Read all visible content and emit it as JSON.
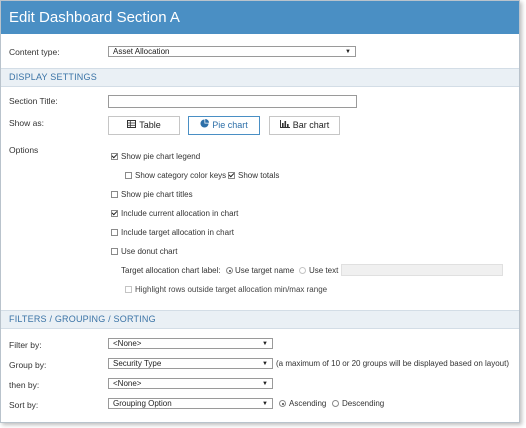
{
  "title": "Edit Dashboard Section A",
  "content_type": {
    "label": "Content type:",
    "value": "Asset Allocation"
  },
  "display_settings": {
    "heading": "DISPLAY SETTINGS",
    "section_title_label": "Section Title:",
    "section_title_value": "",
    "show_as_label": "Show as:",
    "buttons": {
      "table": "Table",
      "pie": "Pie chart",
      "bar": "Bar chart"
    },
    "selected": "Pie chart",
    "options_label": "Options",
    "options": {
      "show_legend": {
        "label": "Show pie chart legend",
        "checked": true
      },
      "show_color_keys": {
        "label": "Show category color keys",
        "checked": false
      },
      "show_totals": {
        "label": "Show totals",
        "checked": true
      },
      "show_titles": {
        "label": "Show pie chart titles",
        "checked": false
      },
      "include_current": {
        "label": "Include current allocation in chart",
        "checked": true
      },
      "include_target": {
        "label": "Include target allocation in chart",
        "checked": false
      },
      "use_donut": {
        "label": "Use donut chart",
        "checked": false
      }
    },
    "target_label": {
      "label": "Target allocation chart label:",
      "option_name": "Use target name",
      "option_text": "Use text",
      "selected": "Use target name",
      "text_value": ""
    },
    "highlight_rows": {
      "label": "Highlight rows outside target allocation min/max range",
      "checked": false,
      "disabled": true
    }
  },
  "filters": {
    "heading": "FILTERS / GROUPING / SORTING",
    "filter_by": {
      "label": "Filter by:",
      "value": "<None>"
    },
    "group_by": {
      "label": "Group by:",
      "value": "Security Type",
      "note": "(a maximum of 10 or 20 groups will be displayed based on layout)"
    },
    "then_by": {
      "label": "then by:",
      "value": "<None>"
    },
    "sort_by": {
      "label": "Sort by:",
      "value": "Grouping Option",
      "asc": "Ascending",
      "desc": "Descending",
      "selected": "Ascending"
    }
  },
  "colors": {
    "title_bar": "#4a8fc4",
    "section_bg": "#eaf0f5",
    "section_text": "#3a73a6",
    "active_button": "#4a8fc4"
  }
}
